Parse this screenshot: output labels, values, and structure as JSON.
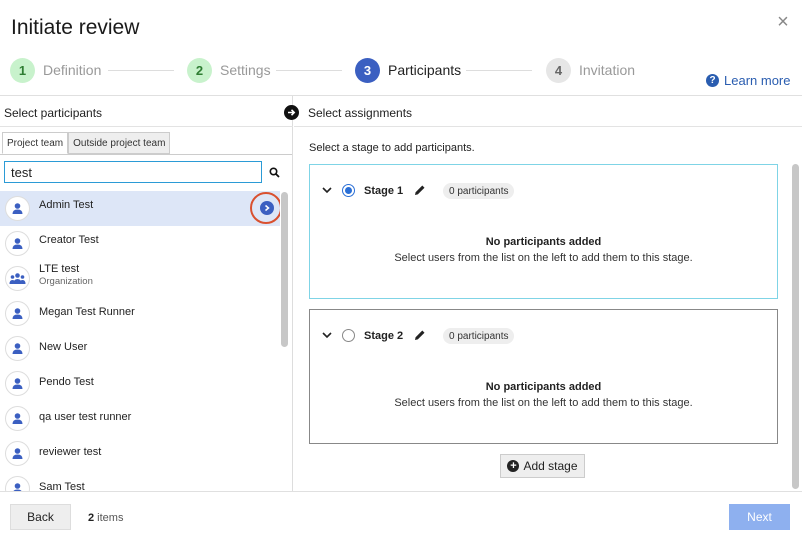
{
  "dialog": {
    "title": "Initiate review",
    "close_label": "×"
  },
  "steps": [
    {
      "num": "1",
      "label": "Definition",
      "state": "done"
    },
    {
      "num": "2",
      "label": "Settings",
      "state": "done"
    },
    {
      "num": "3",
      "label": "Participants",
      "state": "active"
    },
    {
      "num": "4",
      "label": "Invitation",
      "state": "todo"
    }
  ],
  "learn_more": "Learn more",
  "left_panel": {
    "heading": "Select participants",
    "tabs": [
      "Project team",
      "Outside project team"
    ],
    "search_value": "test",
    "users": [
      {
        "name": "Admin Test",
        "sub": "",
        "type": "user"
      },
      {
        "name": "Creator Test",
        "sub": "",
        "type": "user"
      },
      {
        "name": "LTE test",
        "sub": "Organization",
        "type": "org"
      },
      {
        "name": "Megan Test Runner",
        "sub": "",
        "type": "user"
      },
      {
        "name": "New User",
        "sub": "",
        "type": "user"
      },
      {
        "name": "Pendo Test",
        "sub": "",
        "type": "user"
      },
      {
        "name": "qa user test runner",
        "sub": "",
        "type": "user"
      },
      {
        "name": "reviewer test",
        "sub": "",
        "type": "user"
      },
      {
        "name": "Sam Test",
        "sub": "",
        "type": "user"
      }
    ]
  },
  "right_panel": {
    "heading": "Select assignments",
    "instruction": "Select a stage to add participants.",
    "stages": [
      {
        "name": "Stage 1",
        "badge": "0 participants",
        "selected": true,
        "empty_title": "No participants added",
        "empty_sub": "Select users from the list on the left to add them to this stage."
      },
      {
        "name": "Stage 2",
        "badge": "0 participants",
        "selected": false,
        "empty_title": "No participants added",
        "empty_sub": "Select users from the list on the left to add them to this stage."
      }
    ],
    "add_stage_label": "Add stage"
  },
  "footer": {
    "back_label": "Back",
    "count_number": "2",
    "count_suffix": " items",
    "next_label": "Next"
  },
  "colors": {
    "accent": "#3b5fc1",
    "step_done": "#c8f2cc",
    "next_disabled": "#8eb0ef",
    "highlight_ring": "#d9502f"
  }
}
